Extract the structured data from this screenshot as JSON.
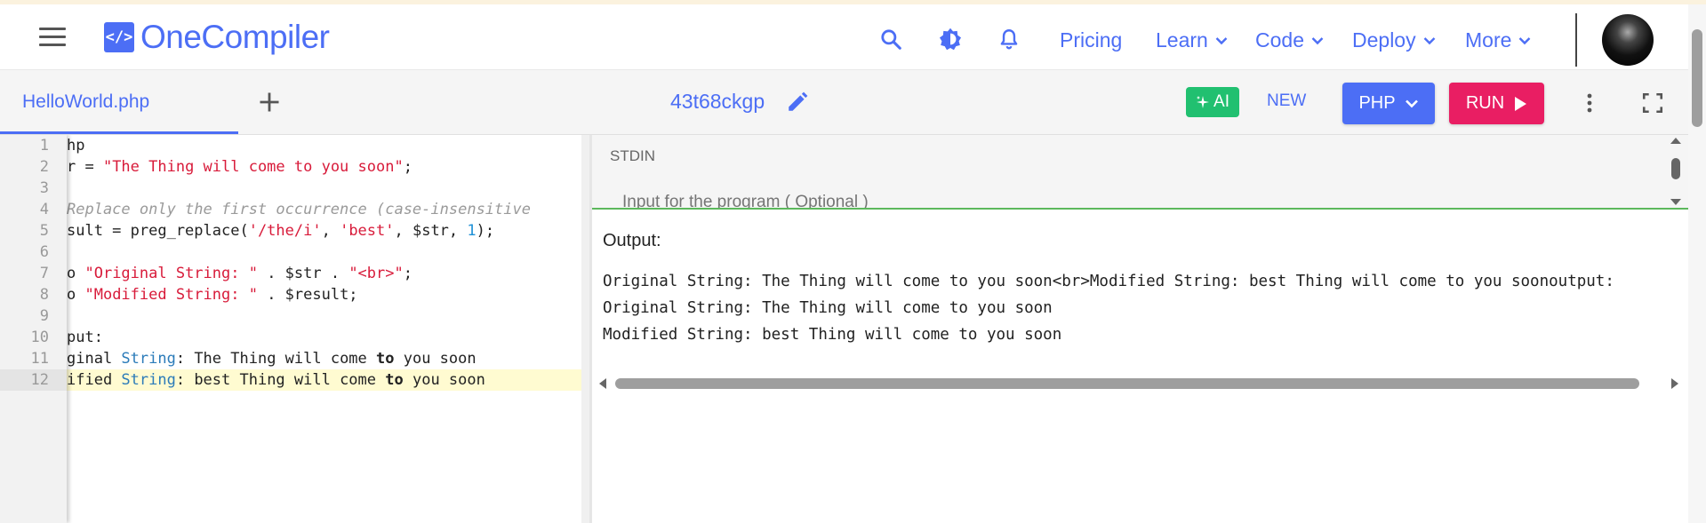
{
  "app": {
    "logo_symbol": "</>",
    "logo_text": "OneCompiler",
    "accent_color": "#4c6ef5",
    "run_color": "#e91e63",
    "ai_color": "#21c070"
  },
  "nav": {
    "links": [
      "Pricing",
      "Learn",
      "Code",
      "Deploy",
      "More"
    ],
    "icons": [
      "search-icon",
      "theme-toggle-icon",
      "bell-icon"
    ]
  },
  "toolbar": {
    "file_tab": "HelloWorld.php",
    "project_id": "43t68ckgp",
    "ai_label": "AI",
    "new_label": "NEW",
    "language": "PHP",
    "run_label": "RUN"
  },
  "editor": {
    "line_numbers": [
      "1",
      "2",
      "3",
      "4",
      "5",
      "6",
      "7",
      "8",
      "9",
      "10",
      "11",
      "12"
    ],
    "active_line": 12
  },
  "stdin": {
    "label": "STDIN",
    "placeholder": "Input for the program ( Optional )"
  },
  "output": {
    "label": "Output:",
    "lines": [
      "Original String: The Thing will come to you soon<br>Modified String: best Thing will come to you soonoutput:",
      "Original String: The Thing will come to you soon",
      "Modified String: best Thing will come to you soon"
    ]
  }
}
